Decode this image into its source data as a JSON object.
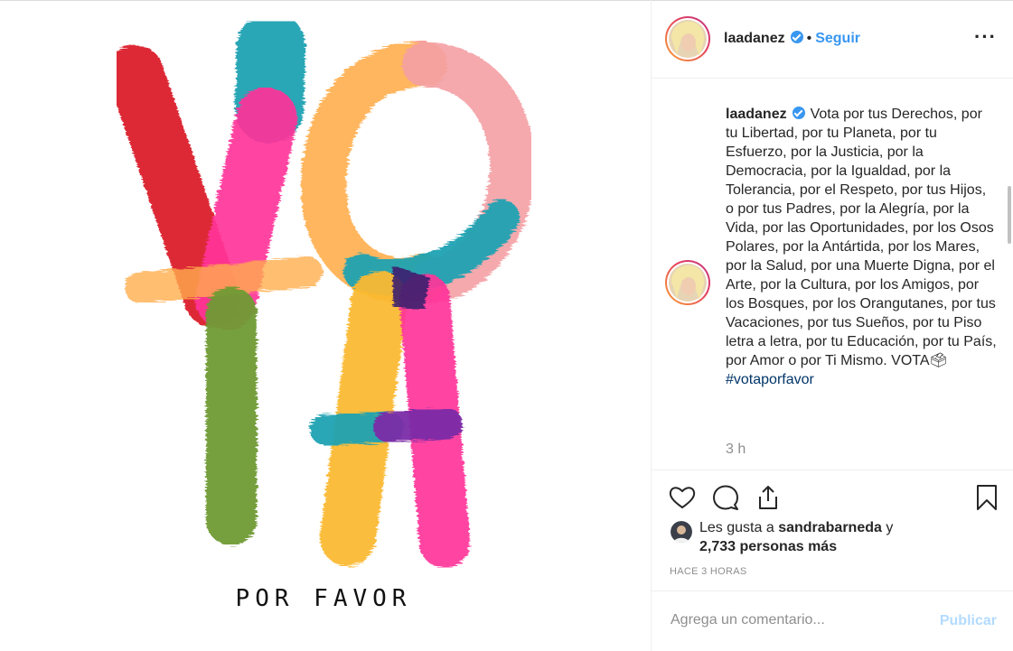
{
  "post": {
    "artwork_text": "POR FAVOR",
    "artwork_colors": {
      "red": "#db1e2b",
      "pink": "#ff3399",
      "teal": "#20a2b2",
      "orange": "#ffae4d",
      "peach": "#f4a0a4",
      "yellow": "#fbb933",
      "green": "#6f9a33",
      "purple": "#7b2aa7"
    }
  },
  "header": {
    "username": "laadanez",
    "separator": "•",
    "follow_label": "Seguir",
    "more_label": "···"
  },
  "caption": {
    "username": "laadanez",
    "text": "Vota por tus Derechos, por tu Libertad, por tu Planeta, por tu Esfuerzo, por la Justicia, por la Democracia, por la Igualdad, por la Tolerancia, por el Respeto, por tus Hijos, o por tus Padres, por la Alegría, por la Vida, por las Oportunidades, por los Osos Polares, por la Antártida, por los Mares, por la Salud, por una Muerte Digna, por el Arte, por la Cultura, por los Amigos, por los Bosques, por los Orangutanes, por tus Vacaciones, por tus Sueños, por tu Piso letra a letra, por tu Educación, por tu País, por Amor o por Ti Mismo. VOTA🗳",
    "hashtag": "#votaporfavor",
    "time": "3 h"
  },
  "likes": {
    "prefix": "Les gusta a",
    "user": "sandrabarneda",
    "conj": "y",
    "count": "2,733 personas más"
  },
  "timestamp": "HACE 3 HORAS",
  "comment": {
    "placeholder": "Agrega un comentario...",
    "publish_label": "Publicar"
  },
  "colors": {
    "accent": "#3897f0",
    "publish_disabled": "#b3dbff",
    "text": "#262626",
    "muted": "#8e8e8e"
  }
}
